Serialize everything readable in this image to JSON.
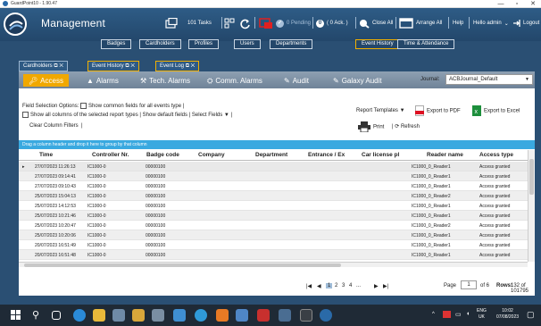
{
  "window": {
    "title": "GuardPoint10 - 1.90.47",
    "controls": [
      "—",
      "▫",
      "✕"
    ]
  },
  "header": {
    "app_title": "Management",
    "tasks_label": "101 Tasks",
    "pending_label": "0 Pending",
    "pending_count": "0",
    "ack_label": "( 0 Ack. )",
    "close_all_label": "Close All",
    "arrange_all_label": "Arrange All",
    "help_label": "Help",
    "user_label": "Hello admin",
    "logout_label": "Logout"
  },
  "subnav": [
    "Badges",
    "Cardholders",
    "Profiles",
    "Users",
    "Departments",
    "Event History",
    "Time & Attendance"
  ],
  "doc_tabs": [
    "Cardholders",
    "Event History",
    "Event Log"
  ],
  "alarm_tabs": [
    "Access",
    "Alarms",
    "Tech. Alarms",
    "Comm. Alarms",
    "Audit",
    "Galaxy Audit"
  ],
  "journal": {
    "label": "Journal:",
    "value": "ACBJournal_Default"
  },
  "options": {
    "field_selection_label": "Field Selection Options:",
    "show_common": "Show common fields for all events type",
    "show_all_columns": "Show all columns of the selected report types",
    "show_default": "Show default fields",
    "select_fields": "Select Fields ▼",
    "clear_filters": "Clear Column Filters",
    "report_templates": "Report Templates ▼",
    "export_pdf": "Export to PDF",
    "export_excel": "Export to Excel",
    "print": "Print",
    "refresh": "Refresh"
  },
  "grid": {
    "group_hint": "Drag a column header and drop it here to group by that column",
    "columns": [
      "Time",
      "Controller Nr.",
      "Badge code",
      "Company",
      "Department",
      "Entrance / Ex",
      "Car license pl",
      "Reader name",
      "Access type"
    ],
    "rows": [
      [
        "27/07/2023 11:26:13",
        "IC1000-0",
        "00000100",
        "",
        "",
        "",
        "",
        "IC1000_0_Reader1",
        "Access granted"
      ],
      [
        "27/07/2023 09:14:41",
        "IC1000-0",
        "00000100",
        "",
        "",
        "",
        "",
        "IC1000_0_Reader1",
        "Access granted"
      ],
      [
        "27/07/2023 09:10:43",
        "IC1000-0",
        "00000100",
        "",
        "",
        "",
        "",
        "IC1000_0_Reader1",
        "Access granted"
      ],
      [
        "25/07/2023 15:04:13",
        "IC1000-0",
        "00000100",
        "",
        "",
        "",
        "",
        "IC1000_0_Reader2",
        "Access granted"
      ],
      [
        "25/07/2023 14:12:53",
        "IC1000-0",
        "00000100",
        "",
        "",
        "",
        "",
        "IC1000_0_Reader1",
        "Access granted"
      ],
      [
        "25/07/2023 10:21:46",
        "IC1000-0",
        "00000100",
        "",
        "",
        "",
        "",
        "IC1000_0_Reader1",
        "Access granted"
      ],
      [
        "25/07/2023 10:20:47",
        "IC1000-0",
        "00000100",
        "",
        "",
        "",
        "",
        "IC1000_0_Reader2",
        "Access granted"
      ],
      [
        "25/07/2023 10:20:06",
        "IC1000-0",
        "00000100",
        "",
        "",
        "",
        "",
        "IC1000_0_Reader1",
        "Access granted"
      ],
      [
        "20/07/2023 16:51:49",
        "IC1000-0",
        "00000100",
        "",
        "",
        "",
        "",
        "IC1000_0_Reader1",
        "Access granted"
      ],
      [
        "20/07/2023 16:51:48",
        "IC1000-0",
        "00000100",
        "",
        "",
        "",
        "",
        "IC1000_0_Reader1",
        "Access granted"
      ]
    ]
  },
  "pager": {
    "pages": [
      "1",
      "2",
      "3",
      "4",
      "..."
    ],
    "page_label": "Page",
    "current_page": "1",
    "of_label": "of 6",
    "rows_label": "Rows:",
    "rows_value": "132 of 101795"
  },
  "taskbar": {
    "lang": "ENG",
    "region": "UK",
    "time": "10:02",
    "date": "07/08/2023"
  },
  "colors": {
    "header": "#2a4f73",
    "accent": "#f0a800",
    "group_bar": "#3aa9e0"
  }
}
